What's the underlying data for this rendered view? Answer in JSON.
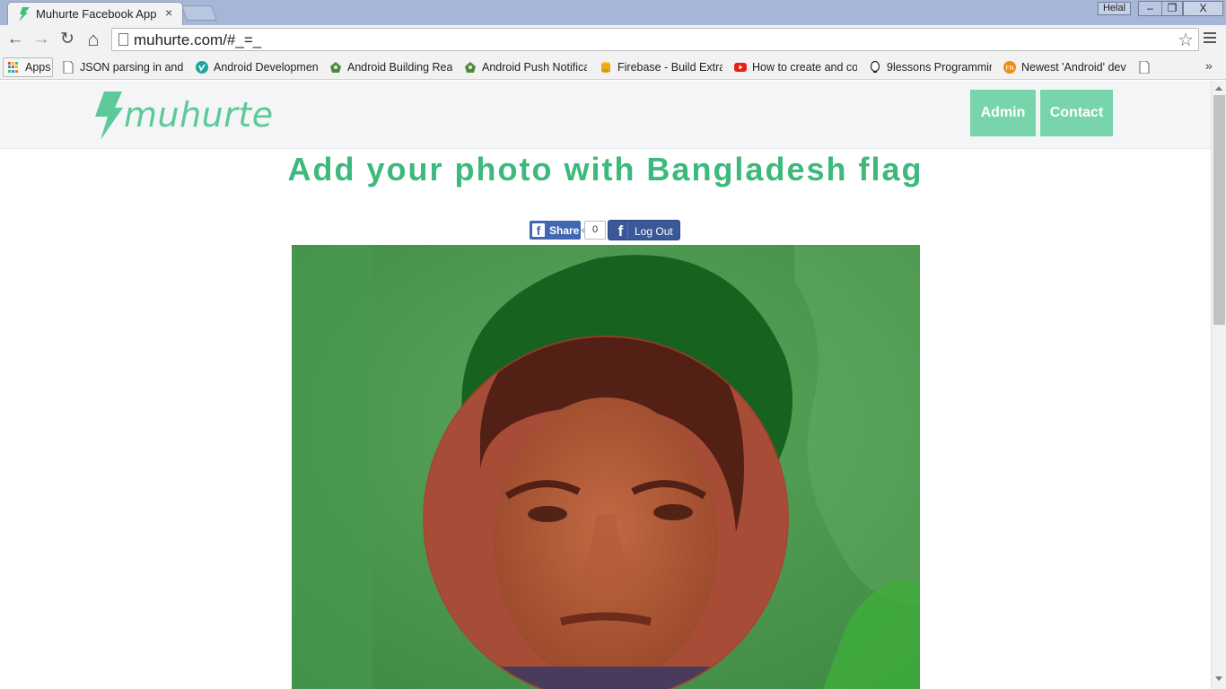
{
  "browser": {
    "tab": {
      "title": "Muhurte Facebook App",
      "close": "×"
    },
    "user_badge": "Helal",
    "window_controls": {
      "minimize": "‒",
      "restore": "❐",
      "close": "X"
    },
    "url": "muhurte.com/#_=_",
    "icons": {
      "back": "back-arrow-icon",
      "forward": "forward-arrow-icon",
      "reload": "reload-icon",
      "home": "home-icon",
      "bookmark_star": "star-icon",
      "menu": "hamburger-menu-icon"
    },
    "glyphs": {
      "back": "←",
      "forward": "→",
      "reload": "↻",
      "home": "⌂",
      "star": "☆",
      "more": "»"
    },
    "bookmarks": [
      {
        "label": "Apps",
        "icon": "apps-grid-icon"
      },
      {
        "label": "JSON parsing in andro",
        "icon": "page-icon"
      },
      {
        "label": "Android Development",
        "icon": "vimeo-icon"
      },
      {
        "label": "Android Building Real",
        "icon": "android-bug-icon"
      },
      {
        "label": "Android Push Notifica",
        "icon": "android-bug-icon"
      },
      {
        "label": "Firebase - Build Extrao",
        "icon": "database-icon"
      },
      {
        "label": "How to create and co",
        "icon": "youtube-icon"
      },
      {
        "label": "9lessons Programmin",
        "icon": "lightbulb-icon"
      },
      {
        "label": "Newest 'Android' dev",
        "icon": "fn-icon"
      }
    ]
  },
  "site": {
    "logo_text": "muhurte",
    "nav": [
      {
        "label": "Admin"
      },
      {
        "label": "Contact"
      }
    ],
    "headline": "Add your photo with Bangladesh flag",
    "facebook": {
      "share_label": "Share",
      "share_count": "0",
      "logout_label": "Log Out"
    }
  },
  "colors": {
    "accent_green": "#3cb97b",
    "nav_button": "#78d4ab",
    "facebook_blue": "#4267b2",
    "flag_red": "#c8332e"
  }
}
